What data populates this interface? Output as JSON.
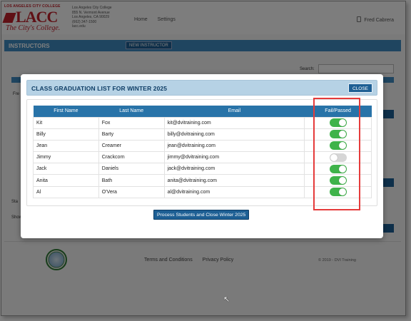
{
  "background": {
    "logo": {
      "top_text": "LOS ANGELES CITY COLLEGE",
      "main_text": "LACC",
      "tagline": "The City's College."
    },
    "address_lines": [
      "Los Angeles City College",
      "855 N. Vermont Avenue",
      "Los Angeles, CA 90029",
      "(662) 347-1500",
      "lacc.edu"
    ],
    "nav": [
      "Home",
      "Settings"
    ],
    "user_name": "Fred Cabrera",
    "section_title": "INSTRUCTORS",
    "new_button": "NEW INSTRUCTOR",
    "search_label": "Search:",
    "frag_fre": "Fre",
    "frag_sta": "Sta",
    "frag_show": "Show",
    "footer_links": [
      "Terms and Conditions",
      "Privacy Policy"
    ],
    "copyright": "© 2019 - DVI Training"
  },
  "modal": {
    "title": "CLASS GRADUATION LIST FOR WINTER 2025",
    "close_label": "CLOSE",
    "columns": [
      "First Name",
      "Last Name",
      "Email",
      "Fail/Passed"
    ],
    "rows": [
      {
        "first": "Kit",
        "last": "Fox",
        "email": "kit@dvitraining.com",
        "passed": true
      },
      {
        "first": "Billy",
        "last": "Barty",
        "email": "billy@dvitraining.com",
        "passed": true
      },
      {
        "first": "Jean",
        "last": "Creamer",
        "email": "jean@dvitraining.com",
        "passed": true
      },
      {
        "first": "Jimmy",
        "last": "Crackcorn",
        "email": "jimmy@dvitraining.com",
        "passed": false
      },
      {
        "first": "Jack",
        "last": "Daniels",
        "email": "jack@dvitraining.com",
        "passed": true
      },
      {
        "first": "Anita",
        "last": "Bath",
        "email": "anita@dvitraining.com",
        "passed": true
      },
      {
        "first": "Al",
        "last": "O'Vera",
        "email": "al@dvitraining.com",
        "passed": true
      }
    ],
    "process_button": "Process Students and Close Winter 2025"
  },
  "colors": {
    "accent": "#1d5f94",
    "header_blue": "#2873a8",
    "toggle_on": "#3fb34a",
    "toggle_off": "#d6d6d6",
    "highlight_red": "#e53b3b"
  }
}
